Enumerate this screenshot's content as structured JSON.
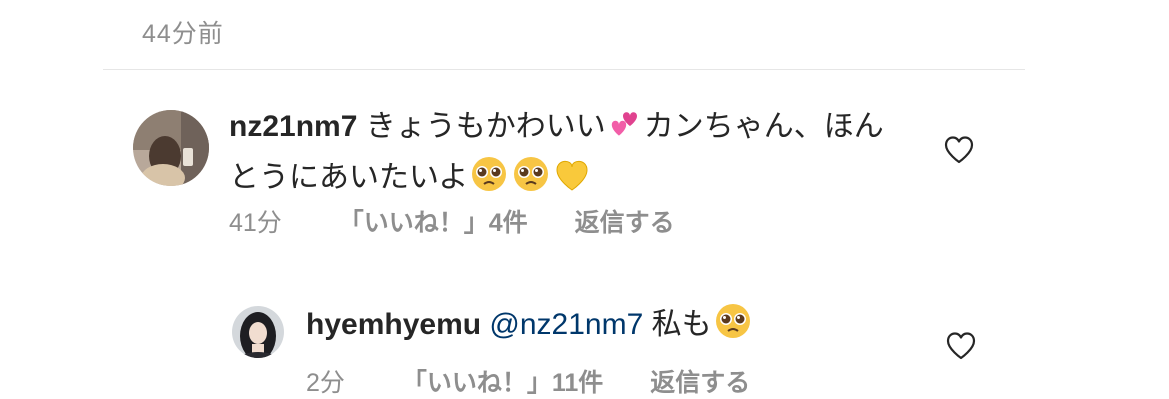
{
  "previous": {
    "time": "44分前"
  },
  "comments": [
    {
      "username": "nz21nm7",
      "text_part1": "きょうもかわいい",
      "emoji1": "two-hearts",
      "text_part2": "カンちゃん、ほんとうにあいたいよ",
      "emoji2": "pleading-face",
      "emoji3": "pleading-face",
      "emoji4": "yellow-heart",
      "time": "41分",
      "likes": "「いいね！」4件",
      "reply": "返信する"
    },
    {
      "username": "hyemhyemu",
      "mention": "@nz21nm7",
      "text": "私も",
      "emoji": "pleading-face",
      "time": "2分",
      "likes": "「いいね！」11件",
      "reply": "返信する"
    }
  ],
  "icons": {
    "like": "heart-outline-icon"
  },
  "colors": {
    "text": "#262626",
    "meta": "#8e8e8e",
    "mention": "#00376b",
    "divider": "#e6e6e6"
  }
}
